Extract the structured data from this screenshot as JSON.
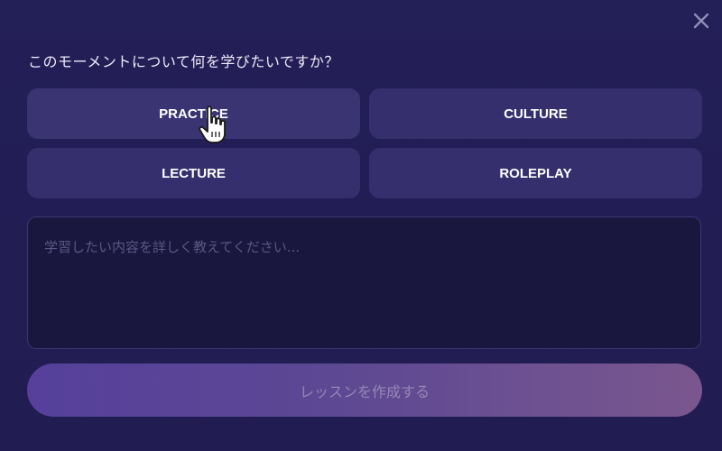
{
  "dialog": {
    "question": "このモーメントについて何を学びたいですか？",
    "close_icon": "close-icon",
    "modes": [
      {
        "label": "PRACTICE"
      },
      {
        "label": "CULTURE"
      },
      {
        "label": "LECTURE"
      },
      {
        "label": "ROLEPLAY"
      }
    ],
    "details": {
      "value": "",
      "placeholder": "学習したい内容を詳しく教えてください..."
    },
    "submit_label": "レッスンを作成する",
    "colors": {
      "background": "#221e54",
      "mode_button": "#35306d",
      "textarea": "#19173e",
      "submit_gradient_start": "#5f46a8",
      "submit_gradient_end": "#8a6098"
    }
  }
}
